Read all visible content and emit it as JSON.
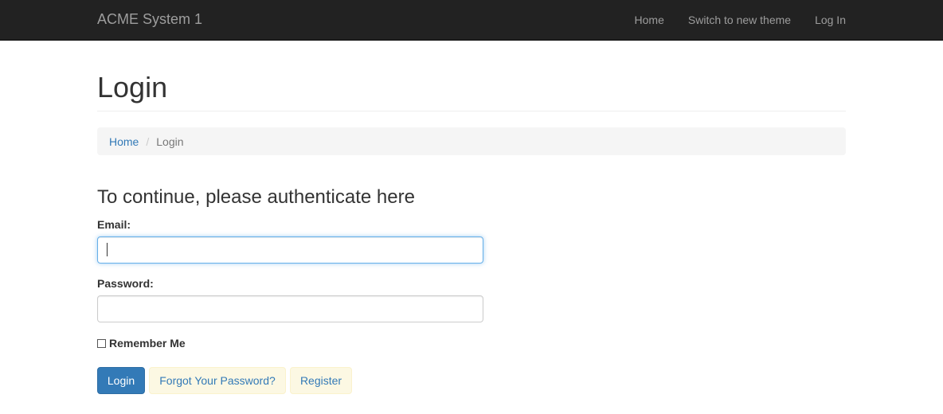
{
  "navbar": {
    "brand": "ACME System 1",
    "items": [
      {
        "label": "Home"
      },
      {
        "label": "Switch to new theme"
      },
      {
        "label": "Log In"
      }
    ]
  },
  "page": {
    "title": "Login"
  },
  "breadcrumb": {
    "items": [
      {
        "label": "Home"
      },
      {
        "label": "Login"
      }
    ],
    "separator": "/"
  },
  "form": {
    "heading": "To continue, please authenticate here",
    "email_label": "Email:",
    "email_value": "",
    "password_label": "Password:",
    "password_value": "",
    "remember_label": "Remember Me",
    "remember_checked": false,
    "login_button": "Login",
    "forgot_button": "Forgot Your Password?",
    "register_button": "Register"
  },
  "colors": {
    "navbar_bg": "#222222",
    "primary": "#337ab7",
    "link_button_bg": "#fcf8e3",
    "focus_border": "#66afe9"
  }
}
